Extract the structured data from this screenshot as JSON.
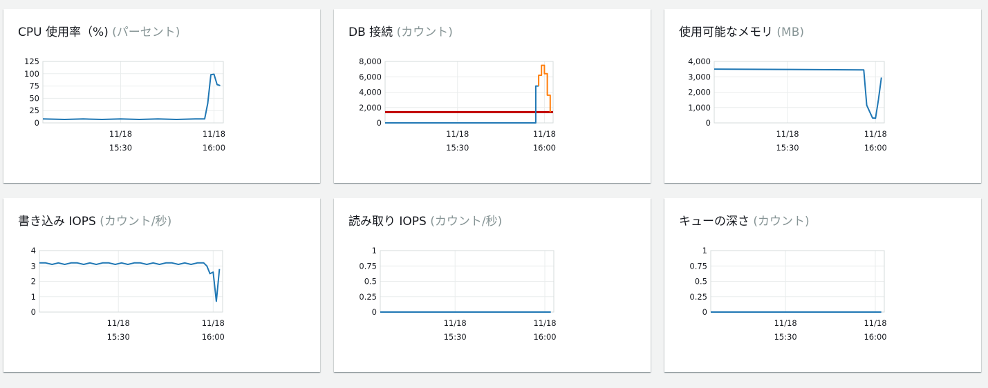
{
  "colors": {
    "series_blue": "#1f77b4",
    "series_orange": "#ff7f0e",
    "threshold_red": "#c00000",
    "grid": "#eaeded",
    "axis": "#d5dbdb",
    "unit_gray": "#879596",
    "title_text": "#16191f"
  },
  "x_axis": {
    "ticks": [
      {
        "date": "11/18",
        "time": "15:30"
      },
      {
        "date": "11/18",
        "time": "16:00"
      }
    ]
  },
  "panels": [
    {
      "title": "CPU 使用率（%)",
      "unit": "(パーセント)"
    },
    {
      "title": "DB 接続",
      "unit": "(カウント)"
    },
    {
      "title": "使用可能なメモリ",
      "unit": "(MB)"
    },
    {
      "title": "書き込み IOPS",
      "unit": "(カウント/秒)"
    },
    {
      "title": "読み取り IOPS",
      "unit": "(カウント/秒)"
    },
    {
      "title": "キューの深さ",
      "unit": "(カウント)"
    }
  ],
  "chart_data": [
    {
      "type": "line",
      "title": "CPU 使用率（%) (パーセント)",
      "x_range": [
        "11/18 15:05",
        "11/18 16:03"
      ],
      "ylim": [
        0,
        125
      ],
      "y_ticks": [
        "125",
        "100",
        "75",
        "50",
        "25",
        "0"
      ],
      "y_tick_values": [
        125,
        100,
        75,
        50,
        25,
        0
      ],
      "series": [
        {
          "color": "#1f77b4",
          "x": [
            "15:05",
            "15:12",
            "15:18",
            "15:24",
            "15:30",
            "15:36",
            "15:42",
            "15:48",
            "15:54",
            "15:57",
            "15:58",
            "15:59",
            "16:00",
            "16:01",
            "16:02"
          ],
          "y": [
            8,
            7,
            8,
            7,
            8,
            7,
            8,
            7,
            8,
            8,
            40,
            98,
            99,
            78,
            76
          ]
        }
      ]
    },
    {
      "type": "line",
      "title": "DB 接続 (カウント)",
      "x_range": [
        "11/18 15:05",
        "11/18 16:03"
      ],
      "ylim": [
        0,
        8000
      ],
      "y_ticks": [
        "8,000",
        "6,000",
        "4,000",
        "2,000",
        "0"
      ],
      "y_tick_values": [
        8000,
        6000,
        4000,
        2000,
        0
      ],
      "threshold": 1400,
      "series": [
        {
          "color": "#1f77b4",
          "x": [
            "15:05",
            "15:57",
            "15:57",
            "15:58"
          ],
          "y": [
            0,
            0,
            4800,
            4800
          ]
        },
        {
          "color": "#ff7f0e",
          "x": [
            "15:58",
            "15:58",
            "15:59",
            "15:59",
            "16:00",
            "16:00",
            "16:01",
            "16:01",
            "16:02",
            "16:02"
          ],
          "y": [
            4800,
            6200,
            6200,
            7500,
            7500,
            6400,
            6400,
            3600,
            3600,
            1400
          ]
        }
      ]
    },
    {
      "type": "line",
      "title": "使用可能なメモリ (MB)",
      "x_range": [
        "11/18 15:05",
        "11/18 16:03"
      ],
      "ylim": [
        0,
        4000
      ],
      "y_ticks": [
        "4,000",
        "3,000",
        "2,000",
        "1,000",
        "0"
      ],
      "y_tick_values": [
        4000,
        3000,
        2000,
        1000,
        0
      ],
      "series": [
        {
          "color": "#1f77b4",
          "x": [
            "15:05",
            "15:30",
            "15:56",
            "15:57",
            "15:59",
            "16:00",
            "16:01",
            "16:02"
          ],
          "y": [
            3500,
            3480,
            3450,
            1150,
            320,
            300,
            1500,
            2950
          ]
        }
      ]
    },
    {
      "type": "line",
      "title": "書き込み IOPS (カウント/秒)",
      "x_range": [
        "11/18 15:05",
        "11/18 16:03"
      ],
      "ylim": [
        0,
        4
      ],
      "y_ticks": [
        "4",
        "3",
        "2",
        "1",
        "0"
      ],
      "y_tick_values": [
        4,
        3,
        2,
        1,
        0
      ],
      "series": [
        {
          "color": "#1f77b4",
          "x": [
            "15:05",
            "15:07",
            "15:09",
            "15:11",
            "15:13",
            "15:15",
            "15:17",
            "15:19",
            "15:21",
            "15:23",
            "15:25",
            "15:27",
            "15:29",
            "15:31",
            "15:33",
            "15:35",
            "15:37",
            "15:39",
            "15:41",
            "15:43",
            "15:45",
            "15:47",
            "15:49",
            "15:51",
            "15:53",
            "15:55",
            "15:56",
            "15:57",
            "15:58",
            "15:59",
            "16:00",
            "16:01",
            "16:02"
          ],
          "y": [
            3.2,
            3.2,
            3.1,
            3.2,
            3.1,
            3.2,
            3.2,
            3.1,
            3.2,
            3.1,
            3.2,
            3.2,
            3.1,
            3.2,
            3.1,
            3.2,
            3.2,
            3.1,
            3.2,
            3.1,
            3.2,
            3.2,
            3.1,
            3.2,
            3.1,
            3.2,
            3.2,
            3.2,
            3.0,
            2.5,
            2.6,
            0.7,
            2.8
          ]
        }
      ]
    },
    {
      "type": "line",
      "title": "読み取り IOPS (カウント/秒)",
      "x_range": [
        "11/18 15:05",
        "11/18 16:03"
      ],
      "ylim": [
        0,
        1
      ],
      "y_ticks": [
        "1",
        "0.75",
        "0.5",
        "0.25",
        "0"
      ],
      "y_tick_values": [
        1,
        0.75,
        0.5,
        0.25,
        0
      ],
      "series": [
        {
          "color": "#1f77b4",
          "x": [
            "15:05",
            "16:02"
          ],
          "y": [
            0,
            0
          ]
        }
      ]
    },
    {
      "type": "line",
      "title": "キューの深さ (カウント)",
      "x_range": [
        "11/18 15:05",
        "11/18 16:03"
      ],
      "ylim": [
        0,
        1
      ],
      "y_ticks": [
        "1",
        "0.75",
        "0.5",
        "0.25",
        "0"
      ],
      "y_tick_values": [
        1,
        0.75,
        0.5,
        0.25,
        0
      ],
      "series": [
        {
          "color": "#1f77b4",
          "x": [
            "15:05",
            "16:02"
          ],
          "y": [
            0,
            0
          ]
        }
      ]
    }
  ]
}
